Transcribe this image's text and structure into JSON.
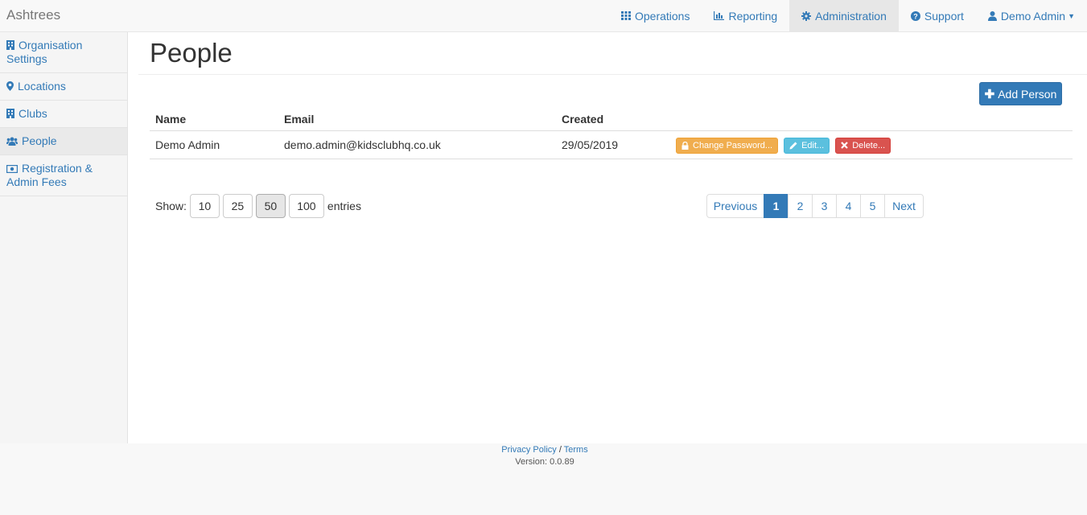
{
  "brand": "Ashtrees",
  "nav": {
    "operations": "Operations",
    "reporting": "Reporting",
    "administration": "Administration",
    "support": "Support",
    "user": "Demo Admin"
  },
  "sidebar": {
    "items": [
      {
        "label": "Organisation Settings",
        "icon": "building-icon"
      },
      {
        "label": "Locations",
        "icon": "map-marker-icon"
      },
      {
        "label": "Clubs",
        "icon": "building-icon"
      },
      {
        "label": "People",
        "icon": "users-icon",
        "active": true
      },
      {
        "label": "Registration & Admin Fees",
        "icon": "money-icon"
      }
    ]
  },
  "page": {
    "title": "People",
    "add_button": "Add Person"
  },
  "table": {
    "headers": {
      "name": "Name",
      "email": "Email",
      "created": "Created"
    },
    "rows": [
      {
        "name": "Demo Admin",
        "email": "demo.admin@kidsclubhq.co.uk",
        "created": "29/05/2019"
      }
    ],
    "actions": {
      "change_password": "Change Password...",
      "edit": "Edit...",
      "delete": "Delete..."
    }
  },
  "length": {
    "show_label": "Show:",
    "entries_label": "entries",
    "options": [
      "10",
      "25",
      "50",
      "100"
    ],
    "selected": "50"
  },
  "pagination": {
    "previous": "Previous",
    "pages": [
      "1",
      "2",
      "3",
      "4",
      "5"
    ],
    "current": "1",
    "next": "Next"
  },
  "footer": {
    "privacy": "Privacy Policy",
    "separator": "/",
    "terms": "Terms",
    "version": "Version: 0.0.89"
  },
  "colors": {
    "primary": "#337ab7",
    "warning": "#f0ad4e",
    "info": "#5bc0de",
    "danger": "#d9534f"
  }
}
